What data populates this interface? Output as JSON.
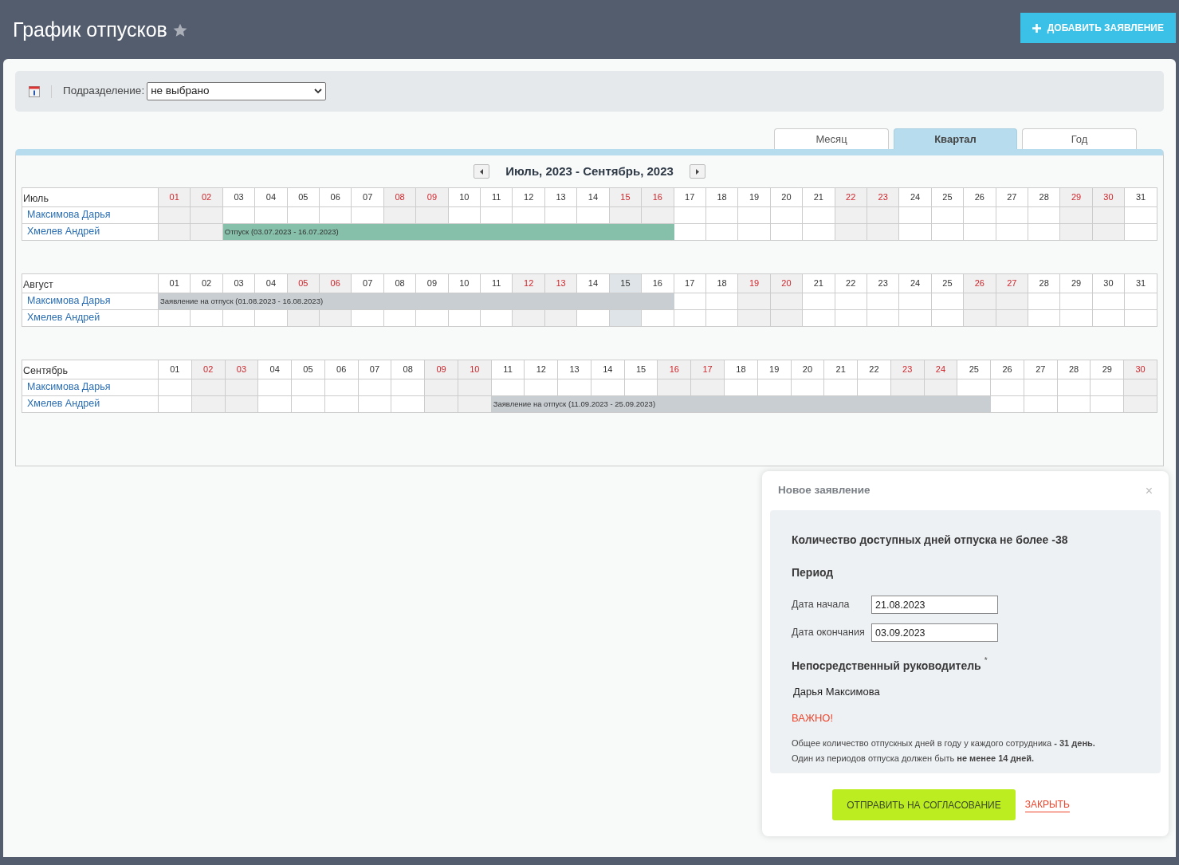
{
  "header": {
    "title": "График отпусков",
    "add_button": "ДОБАВИТЬ ЗАЯВЛЕНИЕ"
  },
  "filter": {
    "label": "Подразделение:",
    "value": "не выбрано"
  },
  "view_tabs": [
    {
      "label": "Месяц",
      "selected": false
    },
    {
      "label": "Квартал",
      "selected": true
    },
    {
      "label": "Год",
      "selected": false
    }
  ],
  "period": {
    "title": "Июль, 2023 - Сентябрь, 2023"
  },
  "months": [
    {
      "name": "Июль",
      "days": [
        {
          "label": "01",
          "weekend": true,
          "today": false
        },
        {
          "label": "02",
          "weekend": true,
          "today": false
        },
        {
          "label": "03",
          "weekend": false,
          "today": false
        },
        {
          "label": "04",
          "weekend": false,
          "today": false
        },
        {
          "label": "05",
          "weekend": false,
          "today": false
        },
        {
          "label": "06",
          "weekend": false,
          "today": false
        },
        {
          "label": "07",
          "weekend": false,
          "today": false
        },
        {
          "label": "08",
          "weekend": true,
          "today": false
        },
        {
          "label": "09",
          "weekend": true,
          "today": false
        },
        {
          "label": "10",
          "weekend": false,
          "today": false
        },
        {
          "label": "11",
          "weekend": false,
          "today": false
        },
        {
          "label": "12",
          "weekend": false,
          "today": false
        },
        {
          "label": "13",
          "weekend": false,
          "today": false
        },
        {
          "label": "14",
          "weekend": false,
          "today": false
        },
        {
          "label": "15",
          "weekend": true,
          "today": false
        },
        {
          "label": "16",
          "weekend": true,
          "today": false
        },
        {
          "label": "17",
          "weekend": false,
          "today": false
        },
        {
          "label": "18",
          "weekend": false,
          "today": false
        },
        {
          "label": "19",
          "weekend": false,
          "today": false
        },
        {
          "label": "20",
          "weekend": false,
          "today": false
        },
        {
          "label": "21",
          "weekend": false,
          "today": false
        },
        {
          "label": "22",
          "weekend": true,
          "today": false
        },
        {
          "label": "23",
          "weekend": true,
          "today": false
        },
        {
          "label": "24",
          "weekend": false,
          "today": false
        },
        {
          "label": "25",
          "weekend": false,
          "today": false
        },
        {
          "label": "26",
          "weekend": false,
          "today": false
        },
        {
          "label": "27",
          "weekend": false,
          "today": false
        },
        {
          "label": "28",
          "weekend": false,
          "today": false
        },
        {
          "label": "29",
          "weekend": true,
          "today": false
        },
        {
          "label": "30",
          "weekend": true,
          "today": false
        },
        {
          "label": "31",
          "weekend": false,
          "today": false
        }
      ],
      "employees": [
        {
          "name": "Максимова Дарья"
        },
        {
          "name": "Хмелев Андрей",
          "bar": {
            "kind": "vacation",
            "text": "Отпуск (03.07.2023 - 16.07.2023)"
          },
          "cells": [
            {
              "booked": false
            },
            {
              "booked": false
            },
            {
              "booked": true
            },
            {
              "booked": true
            },
            {
              "booked": true
            },
            {
              "booked": true
            },
            {
              "booked": true
            },
            {
              "booked": true
            },
            {
              "booked": true
            },
            {
              "booked": true
            },
            {
              "booked": true
            },
            {
              "booked": true
            },
            {
              "booked": true
            },
            {
              "booked": true
            },
            {
              "booked": true
            },
            {
              "booked": true
            },
            {
              "booked": false
            },
            {
              "booked": false
            },
            {
              "booked": false
            },
            {
              "booked": false
            },
            {
              "booked": false
            },
            {
              "booked": false
            },
            {
              "booked": false
            },
            {
              "booked": false
            },
            {
              "booked": false
            },
            {
              "booked": false
            },
            {
              "booked": false
            },
            {
              "booked": false
            },
            {
              "booked": false
            },
            {
              "booked": false
            },
            {
              "booked": false
            }
          ]
        }
      ]
    },
    {
      "name": "Август",
      "days": [
        {
          "label": "01",
          "weekend": false,
          "today": false
        },
        {
          "label": "02",
          "weekend": false,
          "today": false
        },
        {
          "label": "03",
          "weekend": false,
          "today": false
        },
        {
          "label": "04",
          "weekend": false,
          "today": false
        },
        {
          "label": "05",
          "weekend": true,
          "today": false
        },
        {
          "label": "06",
          "weekend": true,
          "today": false
        },
        {
          "label": "07",
          "weekend": false,
          "today": false
        },
        {
          "label": "08",
          "weekend": false,
          "today": false
        },
        {
          "label": "09",
          "weekend": false,
          "today": false
        },
        {
          "label": "10",
          "weekend": false,
          "today": false
        },
        {
          "label": "11",
          "weekend": false,
          "today": false
        },
        {
          "label": "12",
          "weekend": true,
          "today": false
        },
        {
          "label": "13",
          "weekend": true,
          "today": false
        },
        {
          "label": "14",
          "weekend": false,
          "today": false
        },
        {
          "label": "15",
          "weekend": false,
          "today": true
        },
        {
          "label": "16",
          "weekend": false,
          "today": false
        },
        {
          "label": "17",
          "weekend": false,
          "today": false
        },
        {
          "label": "18",
          "weekend": false,
          "today": false
        },
        {
          "label": "19",
          "weekend": true,
          "today": false
        },
        {
          "label": "20",
          "weekend": true,
          "today": false
        },
        {
          "label": "21",
          "weekend": false,
          "today": false
        },
        {
          "label": "22",
          "weekend": false,
          "today": false
        },
        {
          "label": "23",
          "weekend": false,
          "today": false
        },
        {
          "label": "24",
          "weekend": false,
          "today": false
        },
        {
          "label": "25",
          "weekend": false,
          "today": false
        },
        {
          "label": "26",
          "weekend": true,
          "today": false
        },
        {
          "label": "27",
          "weekend": true,
          "today": false
        },
        {
          "label": "28",
          "weekend": false,
          "today": false
        },
        {
          "label": "29",
          "weekend": false,
          "today": false
        },
        {
          "label": "30",
          "weekend": false,
          "today": false
        },
        {
          "label": "31",
          "weekend": false,
          "today": false
        }
      ],
      "employees": [
        {
          "name": "Максимова Дарья",
          "bar": {
            "kind": "request",
            "text": "Заявление на отпуск (01.08.2023 - 16.08.2023)"
          },
          "cells": [
            {
              "booked": true
            },
            {
              "booked": true
            },
            {
              "booked": true
            },
            {
              "booked": true
            },
            {
              "booked": true
            },
            {
              "booked": true
            },
            {
              "booked": true
            },
            {
              "booked": true
            },
            {
              "booked": true
            },
            {
              "booked": true
            },
            {
              "booked": true
            },
            {
              "booked": true
            },
            {
              "booked": true
            },
            {
              "booked": true
            },
            {
              "booked": true
            },
            {
              "booked": true
            },
            {
              "booked": false
            },
            {
              "booked": false
            },
            {
              "booked": false
            },
            {
              "booked": false
            },
            {
              "booked": false
            },
            {
              "booked": false
            },
            {
              "booked": false
            },
            {
              "booked": false
            },
            {
              "booked": false
            },
            {
              "booked": false
            },
            {
              "booked": false
            },
            {
              "booked": false
            },
            {
              "booked": false
            },
            {
              "booked": false
            },
            {
              "booked": false
            }
          ]
        },
        {
          "name": "Хмелев Андрей"
        }
      ]
    },
    {
      "name": "Сентябрь",
      "days": [
        {
          "label": "01",
          "weekend": false,
          "today": false
        },
        {
          "label": "02",
          "weekend": true,
          "today": false
        },
        {
          "label": "03",
          "weekend": true,
          "today": false
        },
        {
          "label": "04",
          "weekend": false,
          "today": false
        },
        {
          "label": "05",
          "weekend": false,
          "today": false
        },
        {
          "label": "06",
          "weekend": false,
          "today": false
        },
        {
          "label": "07",
          "weekend": false,
          "today": false
        },
        {
          "label": "08",
          "weekend": false,
          "today": false
        },
        {
          "label": "09",
          "weekend": true,
          "today": false
        },
        {
          "label": "10",
          "weekend": true,
          "today": false
        },
        {
          "label": "11",
          "weekend": false,
          "today": false
        },
        {
          "label": "12",
          "weekend": false,
          "today": false
        },
        {
          "label": "13",
          "weekend": false,
          "today": false
        },
        {
          "label": "14",
          "weekend": false,
          "today": false
        },
        {
          "label": "15",
          "weekend": false,
          "today": false
        },
        {
          "label": "16",
          "weekend": true,
          "today": false
        },
        {
          "label": "17",
          "weekend": true,
          "today": false
        },
        {
          "label": "18",
          "weekend": false,
          "today": false
        },
        {
          "label": "19",
          "weekend": false,
          "today": false
        },
        {
          "label": "20",
          "weekend": false,
          "today": false
        },
        {
          "label": "21",
          "weekend": false,
          "today": false
        },
        {
          "label": "22",
          "weekend": false,
          "today": false
        },
        {
          "label": "23",
          "weekend": true,
          "today": false
        },
        {
          "label": "24",
          "weekend": true,
          "today": false
        },
        {
          "label": "25",
          "weekend": false,
          "today": false
        },
        {
          "label": "26",
          "weekend": false,
          "today": false
        },
        {
          "label": "27",
          "weekend": false,
          "today": false
        },
        {
          "label": "28",
          "weekend": false,
          "today": false
        },
        {
          "label": "29",
          "weekend": false,
          "today": false
        },
        {
          "label": "30",
          "weekend": true,
          "today": false
        }
      ],
      "employees": [
        {
          "name": "Максимова Дарья"
        },
        {
          "name": "Хмелев Андрей",
          "bar": {
            "kind": "request",
            "text": "Заявление на отпуск (11.09.2023 - 25.09.2023)"
          },
          "cells": [
            {
              "booked": false
            },
            {
              "booked": false
            },
            {
              "booked": false
            },
            {
              "booked": false
            },
            {
              "booked": false
            },
            {
              "booked": false
            },
            {
              "booked": false
            },
            {
              "booked": false
            },
            {
              "booked": false
            },
            {
              "booked": false
            },
            {
              "booked": true
            },
            {
              "booked": true
            },
            {
              "booked": true
            },
            {
              "booked": true
            },
            {
              "booked": true
            },
            {
              "booked": true
            },
            {
              "booked": true
            },
            {
              "booked": true
            },
            {
              "booked": true
            },
            {
              "booked": true
            },
            {
              "booked": true
            },
            {
              "booked": true
            },
            {
              "booked": true
            },
            {
              "booked": true
            },
            {
              "booked": true
            },
            {
              "booked": false
            },
            {
              "booked": false
            },
            {
              "booked": false
            },
            {
              "booked": false
            },
            {
              "booked": false
            }
          ]
        }
      ]
    }
  ],
  "dialog": {
    "title": "Новое заявление",
    "close_icon": "×",
    "available_days": "Количество доступных дней отпуска не более -38",
    "period_heading": "Период",
    "fields": [
      {
        "label": "Дата начала",
        "value": "21.08.2023"
      },
      {
        "label": "Дата окончания",
        "value": "03.09.2023"
      }
    ],
    "manager_heading": "Непосредственный руководитель",
    "required_mark": "*",
    "manager": "Дарья Максимова",
    "important": "ВАЖНО!",
    "notes": [
      "Общее количество отпускных дней в году у каждого сотрудника **- 31 день.**",
      "Один из периодов отпуска должен быть **не менее 14 дней.**"
    ],
    "submit": "ОТПРАВИТЬ НА СОГЛАСОВАНИЕ",
    "close": "ЗАКРЫТЬ"
  }
}
